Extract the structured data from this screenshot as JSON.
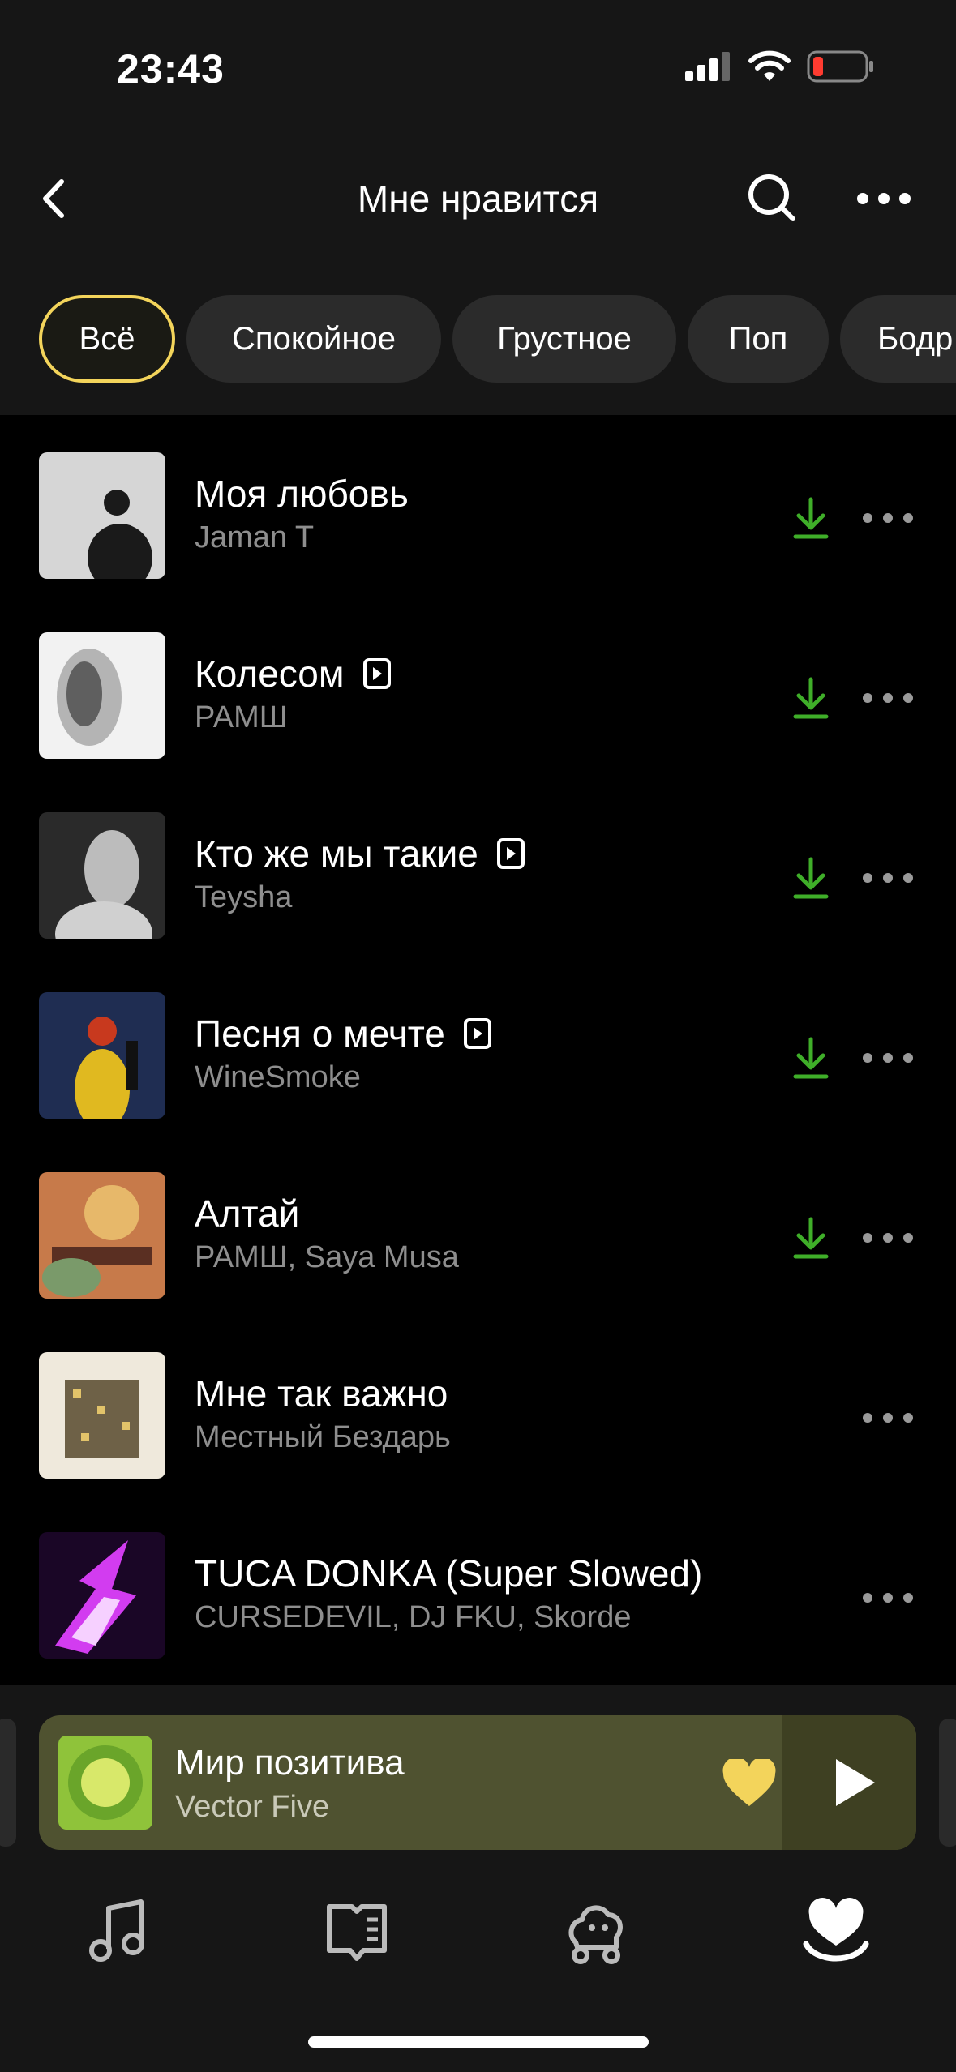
{
  "status": {
    "time": "23:43",
    "icons": [
      "signal-icon",
      "wifi-icon",
      "battery-low-icon"
    ]
  },
  "header": {
    "title": "Мне нравится",
    "icons": [
      "back-icon",
      "search-icon",
      "more-icon"
    ]
  },
  "chips": [
    {
      "label": "Всё",
      "active": true
    },
    {
      "label": "Спокойное",
      "active": false
    },
    {
      "label": "Грустное",
      "active": false
    },
    {
      "label": "Поп",
      "active": false
    },
    {
      "label": "Бодр",
      "active": false
    }
  ],
  "tracks": [
    {
      "title": "Моя любовь",
      "artist": "Jaman T",
      "clip": false,
      "downloaded": true
    },
    {
      "title": "Колесом",
      "artist": "РАМШ",
      "clip": true,
      "downloaded": true
    },
    {
      "title": "Кто же мы такие",
      "artist": "Teysha",
      "clip": true,
      "downloaded": true
    },
    {
      "title": "Песня о мечте",
      "artist": "WineSmoke",
      "clip": true,
      "downloaded": true
    },
    {
      "title": "Алтай",
      "artist": "РАМШ, Saya Musa",
      "clip": false,
      "downloaded": true
    },
    {
      "title": "Мне так важно",
      "artist": "Местный Бездарь",
      "clip": false,
      "downloaded": false
    },
    {
      "title": "TUCA DONKA (Super Slowed)",
      "artist": "CURSEDEVIL, DJ FKU, Skorde",
      "clip": false,
      "downloaded": false
    }
  ],
  "player": {
    "title": "Мир позитива",
    "artist": "Vector Five",
    "liked": true
  },
  "tabbar": [
    "music-note-icon",
    "book-icon",
    "kids-icon",
    "heart-collection-icon"
  ],
  "colors": {
    "accent": "#f3d45b",
    "download": "#3fae29",
    "background": "#000000",
    "panel": "#161616"
  }
}
